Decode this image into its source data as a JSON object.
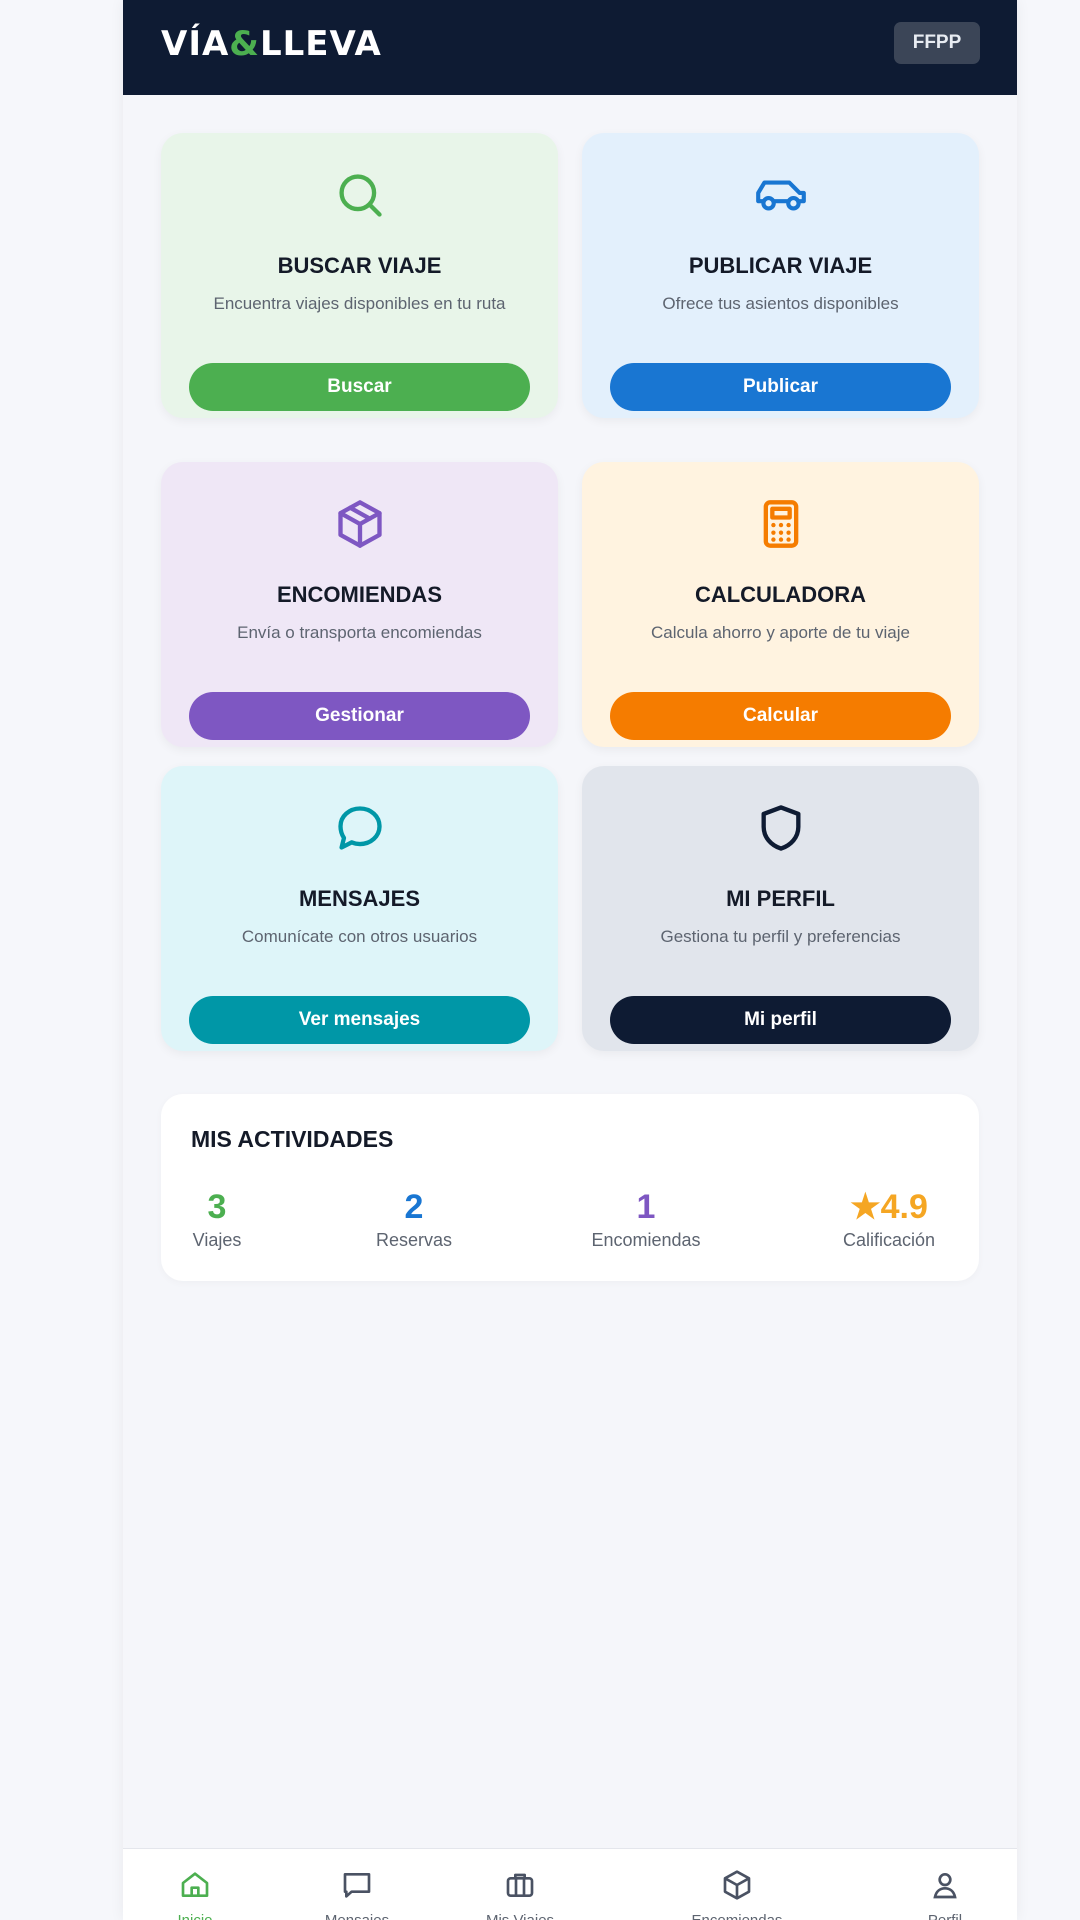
{
  "app": {
    "logo_part1": "VÍA",
    "logo_amp": "&",
    "logo_part2": "LLEVA",
    "user_badge": "FFPP"
  },
  "cards": [
    {
      "title": "BUSCAR VIAJE",
      "description": "Encuentra viajes disponibles en tu ruta",
      "button": "Buscar",
      "icon": "search-icon",
      "bg": "#e8f5e9",
      "accent": "#4caf50"
    },
    {
      "title": "PUBLICAR VIAJE",
      "description": "Ofrece tus asientos disponibles",
      "button": "Publicar",
      "icon": "car-icon",
      "bg": "#e3f0fc",
      "accent": "#1976d2"
    },
    {
      "title": "ENCOMIENDAS",
      "description": "Envía o transporta encomiendas",
      "button": "Gestionar",
      "icon": "package-icon",
      "bg": "#efe7f6",
      "accent": "#7e57c2"
    },
    {
      "title": "CALCULADORA",
      "description": "Calcula ahorro y aporte de tu viaje",
      "button": "Calcular",
      "icon": "calculator-icon",
      "bg": "#fff3e0",
      "accent": "#f57c00"
    },
    {
      "title": "MENSAJES",
      "description": "Comunícate con otros usuarios",
      "button": "Ver mensajes",
      "icon": "chat-icon",
      "bg": "#def5f9",
      "accent": "#0097a7"
    },
    {
      "title": "MI PERFIL",
      "description": "Gestiona tu perfil y preferencias",
      "button": "Mi perfil",
      "icon": "shield-icon",
      "bg": "#e1e5ec",
      "accent": "#0e1b33"
    }
  ],
  "activities": {
    "title": "MIS ACTIVIDADES",
    "stats": [
      {
        "value": "3",
        "label": "Viajes",
        "color": "#4caf50"
      },
      {
        "value": "2",
        "label": "Reservas",
        "color": "#1976d2"
      },
      {
        "value": "1",
        "label": "Encomiendas",
        "color": "#7e57c2"
      },
      {
        "value": "★4.9",
        "label": "Calificación",
        "color": "#f5a623"
      }
    ]
  },
  "bottom_nav": [
    {
      "icon": "home-icon",
      "label": "Inicio",
      "active": true
    },
    {
      "icon": "chat-icon",
      "label": "Mensajes",
      "active": false
    },
    {
      "icon": "briefcase-icon",
      "label": "Mis Viajes",
      "active": false
    },
    {
      "icon": "package-icon",
      "label": "Encomiendas",
      "active": false
    },
    {
      "icon": "user-icon",
      "label": "Perfil",
      "active": false
    }
  ]
}
